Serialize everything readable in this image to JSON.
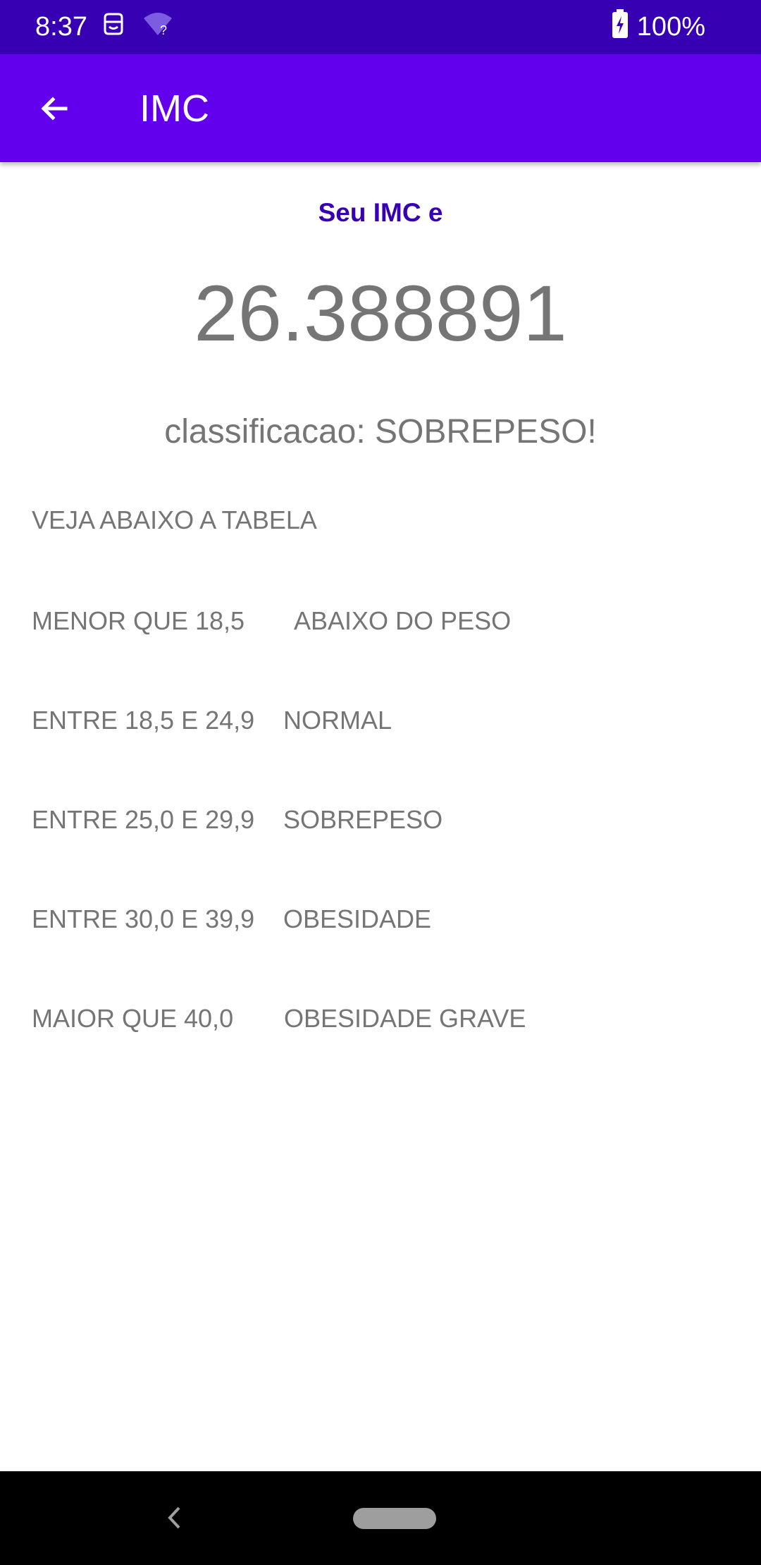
{
  "status_bar": {
    "time": "8:37",
    "battery": "100%",
    "icons": [
      "face-id-icon",
      "wifi-unknown-icon",
      "battery-charging-icon"
    ]
  },
  "app_bar": {
    "title": "IMC",
    "back_icon": "arrow-left-icon",
    "background": "#6200ee"
  },
  "result": {
    "heading": "Seu IMC e",
    "value": "26.388891",
    "classification": "classificacao: SOBREPESO!"
  },
  "table": {
    "heading": "VEJA ABAIXO A TABELA",
    "rows": [
      {
        "range": "MENOR QUE 18,5",
        "label": "ABAIXO DO PESO"
      },
      {
        "range": "ENTRE 18,5 E 24,9",
        "label": "NORMAL"
      },
      {
        "range": "ENTRE 25,0 E 29,9",
        "label": "SOBREPESO"
      },
      {
        "range": "ENTRE 30,0 E 39,9",
        "label": "OBESIDADE"
      },
      {
        "range": "MAIOR QUE 40,0",
        "label": "OBESIDADE GRAVE"
      }
    ]
  },
  "nav_bar": {
    "icons": [
      "nav-back-icon",
      "home-pill-icon"
    ]
  },
  "colors": {
    "status_bar": "#3700b3",
    "app_bar": "#6200ee",
    "accent_text": "#3700b3",
    "body_text": "#757575"
  }
}
